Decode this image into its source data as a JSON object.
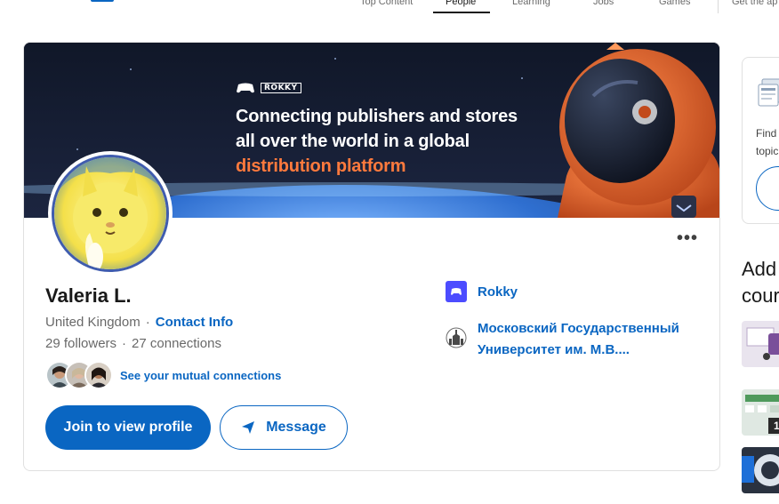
{
  "nav": {
    "items": [
      "Top Content",
      "People",
      "Learning",
      "Jobs",
      "Games",
      "Get the ap"
    ],
    "active": "People"
  },
  "banner": {
    "brand": "ROKKY",
    "line1": "Connecting publishers and stores",
    "line2": "all over the world in a global",
    "line3": "distribution platform"
  },
  "profile": {
    "name": "Valeria L.",
    "location": "United Kingdom",
    "contact_link": "Contact Info",
    "followers": "29 followers",
    "connections": "27 connections",
    "mutual_text": "See your mutual connections",
    "join_label": "Join to view profile",
    "message_label": "Message",
    "company": "Rokky",
    "school": "Московский Государственный Университет им. М.В...."
  },
  "sidebar": {
    "card_text_1": "Find",
    "card_text_2": "topic",
    "section_title_1": "Add",
    "section_title_2": "cour",
    "thumb_badge": "1"
  },
  "colors": {
    "primary": "#0a66c2",
    "banner_accent": "#ff7a3d",
    "company_logo": "#4c4cff"
  }
}
